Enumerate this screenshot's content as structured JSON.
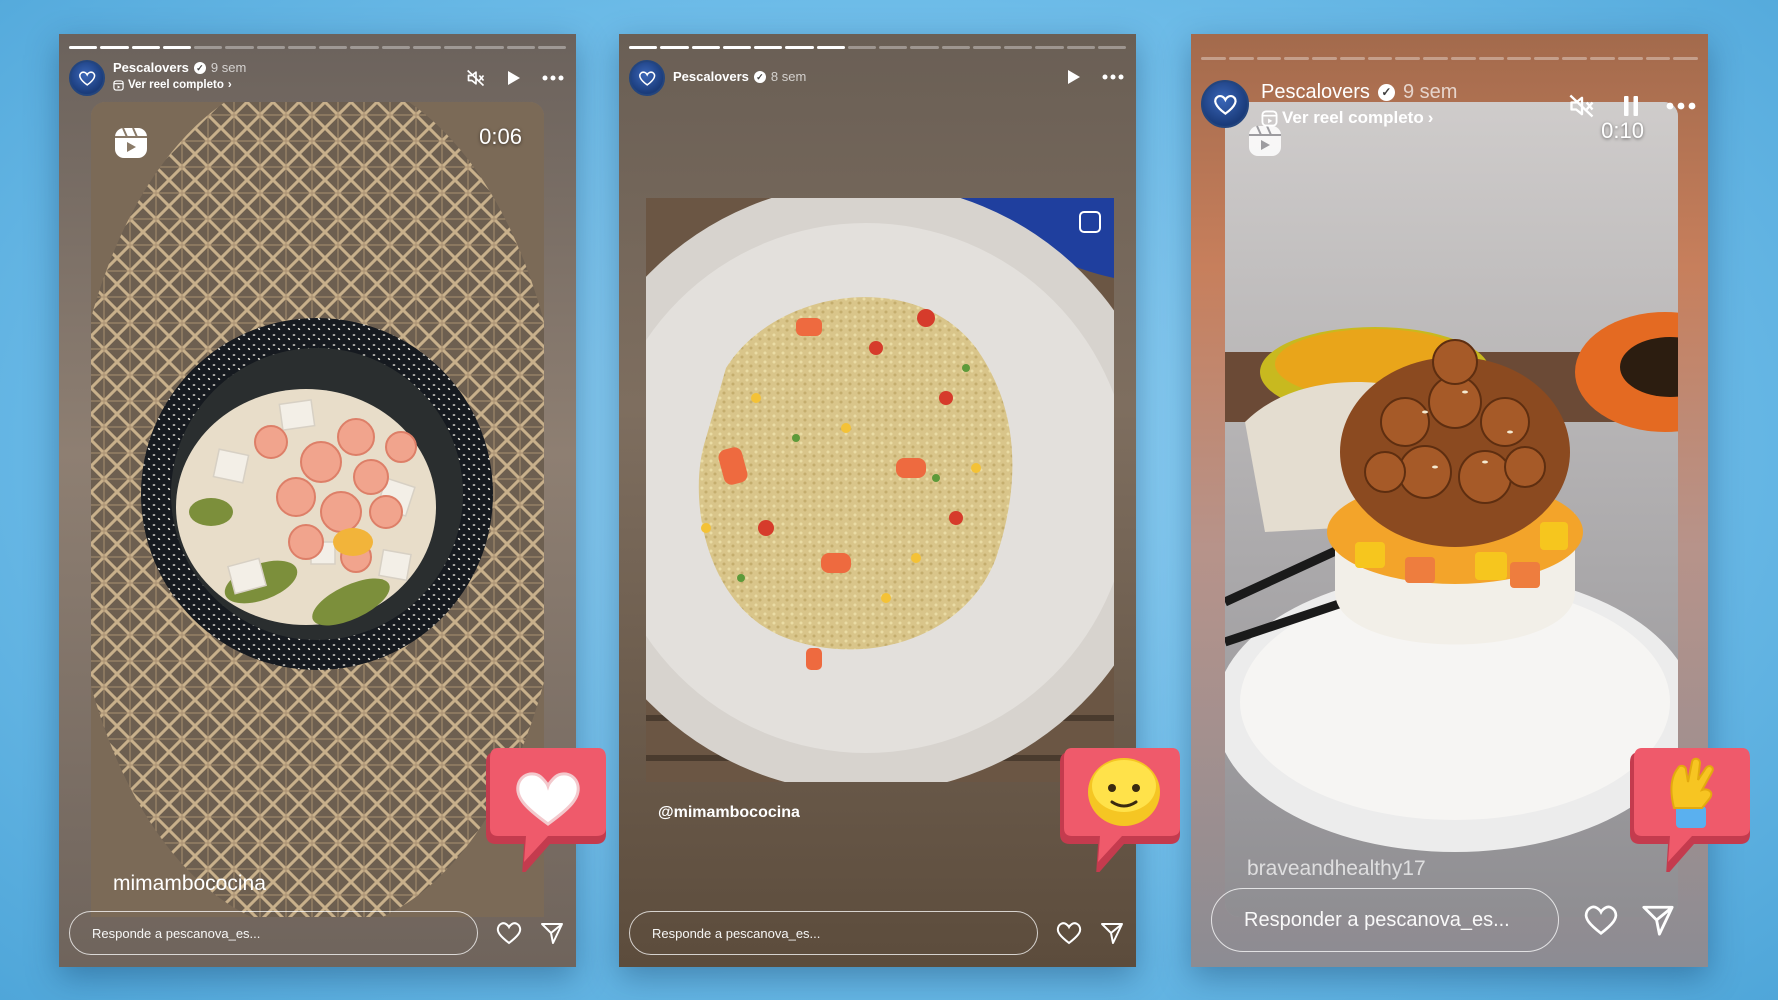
{
  "stories": [
    {
      "username": "Pescalovers",
      "time": "9 sem",
      "reel_link": "Ver reel completo",
      "reel_timer": "0:06",
      "overlay_username": "mimambococina",
      "reply_placeholder": "Responde a pescanova_es...",
      "reaction": "heart",
      "progress_done": 4,
      "progress_total": 16,
      "controls": [
        "mute-icon",
        "play-icon",
        "more-icon"
      ]
    },
    {
      "username": "Pescalovers",
      "time": "8 sem",
      "reel_link": "",
      "reel_timer": "",
      "overlay_username": "@mimambococina",
      "reply_placeholder": "Responde a pescanova_es...",
      "reaction": "smiley",
      "progress_done": 7,
      "progress_total": 16,
      "controls": [
        "play-icon",
        "more-icon"
      ]
    },
    {
      "username": "Pescalovers",
      "time": "9 sem",
      "reel_link": "Ver reel completo",
      "reel_timer": "0:10",
      "overlay_username": "braveandhealthy17",
      "reply_placeholder": "Responder a pescanova_es...",
      "reaction": "wave-hand",
      "progress_done": 0,
      "progress_total": 18,
      "controls": [
        "mute-icon",
        "pause-icon",
        "more-icon"
      ]
    }
  ],
  "colors": {
    "background": "#6fbde9",
    "reaction_bubble": "#ef5a6b",
    "reaction_shadow": "#c43b4e",
    "avatar": "#23457e"
  }
}
